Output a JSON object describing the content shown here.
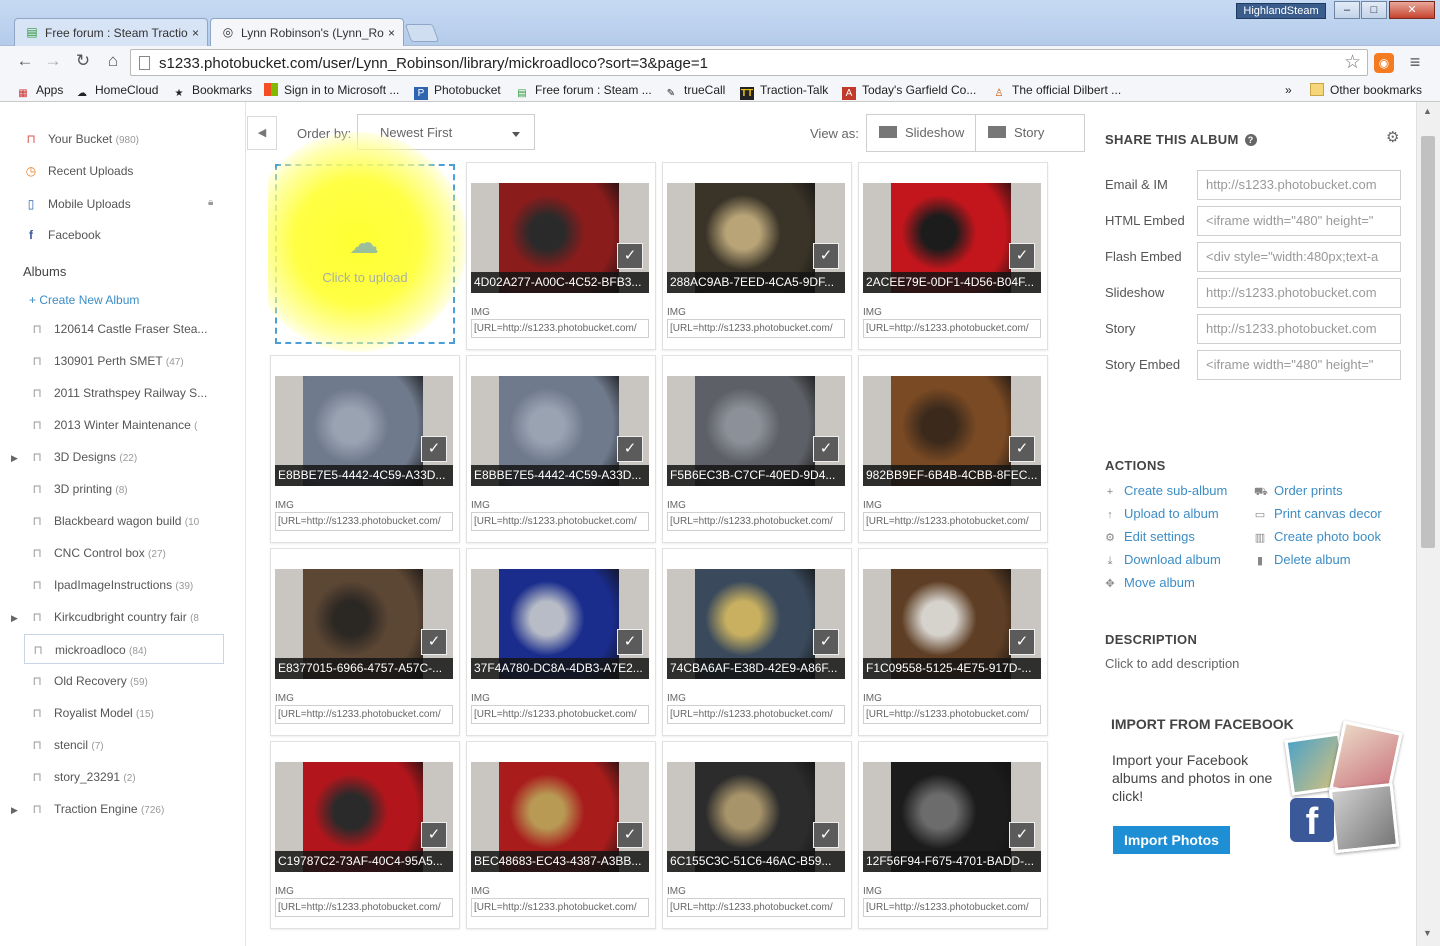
{
  "browser": {
    "tabs": [
      {
        "title": "Free forum : Steam Tractio",
        "close": "×"
      },
      {
        "title": "Lynn Robinson's (Lynn_Ro",
        "close": "×"
      }
    ],
    "user_badge": "HighlandSteam",
    "window_buttons": {
      "minimize": "–",
      "maximize": "□",
      "close": "✕"
    },
    "url": "s1233.photobucket.com/user/Lynn_Robinson/library/mickroadloco?sort=3&page=1",
    "bookmarks": [
      {
        "label": "Apps",
        "icon": "apps-grid-icon"
      },
      {
        "label": "HomeCloud",
        "icon": "cloud-icon"
      },
      {
        "label": "Bookmarks",
        "icon": "star-icon"
      },
      {
        "label": "Sign in to Microsoft ...",
        "icon": "microsoft-icon"
      },
      {
        "label": "Photobucket",
        "icon": "photobucket-icon"
      },
      {
        "label": "Free forum : Steam ...",
        "icon": "forum-icon"
      },
      {
        "label": "trueCall",
        "icon": "pen-icon"
      },
      {
        "label": "Traction-Talk",
        "icon": "tt-icon"
      },
      {
        "label": "Today's Garfield Co...",
        "icon": "garfield-icon"
      },
      {
        "label": "The official Dilbert ...",
        "icon": "dilbert-icon"
      }
    ],
    "bookmarks_overflow": "»",
    "other_bookmarks": "Other bookmarks"
  },
  "sidebar": {
    "top_items": [
      {
        "label": "Your Bucket",
        "count": "(980)",
        "icon": "bucket-icon"
      },
      {
        "label": "Recent Uploads",
        "count": "",
        "icon": "clock-icon"
      },
      {
        "label": "Mobile Uploads",
        "count": "",
        "icon": "phone-icon"
      },
      {
        "label": "Facebook",
        "count": "",
        "icon": "facebook-icon"
      }
    ],
    "albums_heading": "Albums",
    "create_new": "+ Create New Album",
    "albums": [
      {
        "label": "120614 Castle Fraser Stea...",
        "count": "",
        "expandable": false
      },
      {
        "label": "130901 Perth SMET",
        "count": "(47)",
        "expandable": false
      },
      {
        "label": "2011 Strathspey Railway S...",
        "count": "",
        "expandable": false
      },
      {
        "label": "2013 Winter Maintenance",
        "count": "(",
        "expandable": false
      },
      {
        "label": "3D Designs",
        "count": "(22)",
        "expandable": true
      },
      {
        "label": "3D printing",
        "count": "(8)",
        "expandable": false
      },
      {
        "label": "Blackbeard wagon build",
        "count": "(10",
        "expandable": false
      },
      {
        "label": "CNC Control box",
        "count": "(27)",
        "expandable": false
      },
      {
        "label": "IpadImageInstructions",
        "count": "(39)",
        "expandable": false
      },
      {
        "label": "Kirkcudbright country fair",
        "count": "(8",
        "expandable": true
      },
      {
        "label": "mickroadloco",
        "count": "(84)",
        "expandable": false,
        "selected": true
      },
      {
        "label": "Old Recovery",
        "count": "(59)",
        "expandable": false
      },
      {
        "label": "Royalist Model",
        "count": "(15)",
        "expandable": false
      },
      {
        "label": "stencil",
        "count": "(7)",
        "expandable": false
      },
      {
        "label": "story_23291",
        "count": "(2)",
        "expandable": false
      },
      {
        "label": "Traction Engine",
        "count": "(726)",
        "expandable": true
      }
    ]
  },
  "grid_header": {
    "order_label": "Order by:",
    "order_value": "Newest First",
    "view_label": "View as:",
    "slideshow": "Slideshow",
    "story": "Story"
  },
  "upload": {
    "label": "Click to upload"
  },
  "cards": [
    {
      "caption": "4D02A277-A00C-4C52-BFB3...",
      "type": "IMG",
      "code": "[URL=http://s1233.photobucket.com/",
      "palette": [
        "#8a1c1c",
        "#2a2a2a"
      ]
    },
    {
      "caption": "288AC9AB-7EED-4CA5-9DF...",
      "type": "IMG",
      "code": "[URL=http://s1233.photobucket.com/",
      "palette": [
        "#3a3428",
        "#b8a477"
      ]
    },
    {
      "caption": "2ACEE79E-0DF1-4D56-B04F...",
      "type": "IMG",
      "code": "[URL=http://s1233.photobucket.com/",
      "palette": [
        "#c3161c",
        "#1c1c1c"
      ]
    },
    {
      "caption": "E8BBE7E5-4442-4C59-A33D...",
      "type": "IMG",
      "code": "[URL=http://s1233.photobucket.com/",
      "palette": [
        "#6f7a8c",
        "#9aa3b2"
      ]
    },
    {
      "caption": "E8BBE7E5-4442-4C59-A33D...",
      "type": "IMG",
      "code": "[URL=http://s1233.photobucket.com/",
      "palette": [
        "#6f7a8c",
        "#9aa3b2"
      ]
    },
    {
      "caption": "F5B6EC3B-C7CF-40ED-9D4...",
      "type": "IMG",
      "code": "[URL=http://s1233.photobucket.com/",
      "palette": [
        "#5d6066",
        "#8c9098"
      ]
    },
    {
      "caption": "982BB9EF-6B4B-4CBB-8FEC...",
      "type": "IMG",
      "code": "[URL=http://s1233.photobucket.com/",
      "palette": [
        "#7a4a24",
        "#3b2a1c"
      ]
    },
    {
      "caption": "E8377015-6966-4757-A57C-...",
      "type": "IMG",
      "code": "[URL=http://s1233.photobucket.com/",
      "palette": [
        "#5c4634",
        "#2b2723"
      ]
    },
    {
      "caption": "37F4A780-DC8A-4DB3-A7E2...",
      "type": "IMG",
      "code": "[URL=http://s1233.photobucket.com/",
      "palette": [
        "#1a2c8c",
        "#b7bcc6"
      ]
    },
    {
      "caption": "74CBA6AF-E38D-42E9-A86F...",
      "type": "IMG",
      "code": "[URL=http://s1233.photobucket.com/",
      "palette": [
        "#3a4a5c",
        "#c8b060"
      ]
    },
    {
      "caption": "F1C09558-5125-4E75-917D-...",
      "type": "IMG",
      "code": "[URL=http://s1233.photobucket.com/",
      "palette": [
        "#5e3e24",
        "#d6d2cc"
      ]
    },
    {
      "caption": "C19787C2-73AF-40C4-95A5...",
      "type": "IMG",
      "code": "[URL=http://s1233.photobucket.com/",
      "palette": [
        "#b2161c",
        "#2a2a2a"
      ]
    },
    {
      "caption": "BEC48683-EC43-4387-A3BB...",
      "type": "IMG",
      "code": "[URL=http://s1233.photobucket.com/",
      "palette": [
        "#a81c1c",
        "#b89a54"
      ]
    },
    {
      "caption": "6C155C3C-51C6-46AC-B59...",
      "type": "IMG",
      "code": "[URL=http://s1233.photobucket.com/",
      "palette": [
        "#2c2c2c",
        "#a8946a"
      ]
    },
    {
      "caption": "12F56F94-F675-4701-BADD-...",
      "type": "IMG",
      "code": "[URL=http://s1233.photobucket.com/",
      "palette": [
        "#1c1c1c",
        "#6c6c6c"
      ]
    }
  ],
  "share": {
    "heading": "SHARE THIS ALBUM",
    "help": "?",
    "fields": [
      {
        "label": "Email & IM",
        "value": "http://s1233.photobucket.com"
      },
      {
        "label": "HTML Embed",
        "value": "<iframe width=\"480\" height=\""
      },
      {
        "label": "Flash Embed",
        "value": "<div style=\"width:480px;text-a"
      },
      {
        "label": "Slideshow",
        "value": "http://s1233.photobucket.com"
      },
      {
        "label": "Story",
        "value": "http://s1233.photobucket.com"
      },
      {
        "label": "Story Embed",
        "value": "<iframe width=\"480\" height=\""
      }
    ]
  },
  "actions": {
    "heading": "ACTIONS",
    "left": [
      {
        "label": "Create sub-album",
        "icon": "plus-icon"
      },
      {
        "label": "Upload to album",
        "icon": "upload-arrow-icon"
      },
      {
        "label": "Edit settings",
        "icon": "gear-icon"
      },
      {
        "label": "Download album",
        "icon": "download-icon"
      },
      {
        "label": "Move album",
        "icon": "move-icon"
      }
    ],
    "right": [
      {
        "label": "Order prints",
        "icon": "cart-icon"
      },
      {
        "label": "Print canvas decor",
        "icon": "canvas-icon"
      },
      {
        "label": "Create photo book",
        "icon": "book-icon"
      },
      {
        "label": "Delete album",
        "icon": "trash-icon"
      }
    ]
  },
  "description": {
    "heading": "DESCRIPTION",
    "placeholder": "Click to add description"
  },
  "facebook_import": {
    "heading": "IMPORT FROM FACEBOOK",
    "text": "Import your Facebook albums and photos in one click!",
    "button": "Import Photos"
  }
}
